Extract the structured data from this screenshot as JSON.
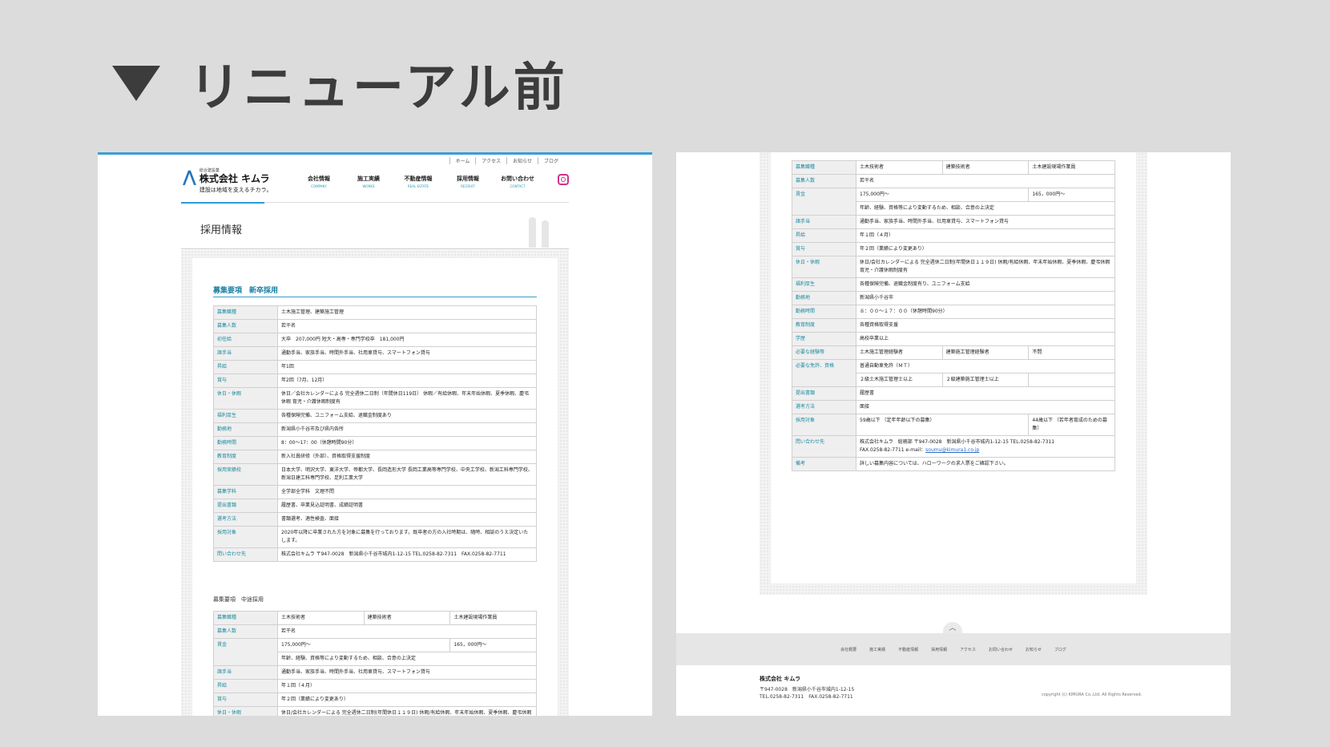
{
  "heading": {
    "title": "リニューアル前"
  },
  "left": {
    "utility_nav": [
      "ホーム",
      "アクセス",
      "お知らせ",
      "ブログ"
    ],
    "logo": {
      "sub": "総合建設業",
      "name": "株式会社 キムラ",
      "tagline": "建設は地域を支えるチカラ。"
    },
    "global_nav": [
      {
        "jp": "会社情報",
        "en": "COMPANY"
      },
      {
        "jp": "施工実績",
        "en": "WORKS"
      },
      {
        "jp": "不動産情報",
        "en": "REAL ESTATE"
      },
      {
        "jp": "採用情報",
        "en": "RECRUIT"
      },
      {
        "jp": "お問い合わせ",
        "en": "CONTACT"
      }
    ],
    "page_title": "採用情報",
    "new_grad": {
      "heading": "募集要項　新卒採用",
      "rows": [
        [
          "募集職種",
          "土木施工管理、建築施工管理"
        ],
        [
          "募集人数",
          "若干名"
        ],
        [
          "初任給",
          "大卒　207,000円 短大・高専・専門学校卒　181,000円"
        ],
        [
          "諸手当",
          "通勤手当、家族手当、時間外手当、社用車貸与、スマートフォン貸与"
        ],
        [
          "昇給",
          "年1回"
        ],
        [
          "賞与",
          "年2回（7月、12月）"
        ],
        [
          "休日・休暇",
          "休日／会社カレンダーによる 完全週休二日制（年間休日119日） 休暇／有給休暇、年末年始休暇、夏季休暇、慶弔休暇 育児・介護休暇制度有"
        ],
        [
          "福利厚生",
          "各種保険完備、ユニフォーム支給、退職金制度あり"
        ],
        [
          "勤務地",
          "新潟県小千谷市及び県内各所"
        ],
        [
          "勤務時間",
          "8：00〜17：00（休憩時間90分）"
        ],
        [
          "教育制度",
          "新入社員研修（外部）、資格取得支援制度"
        ],
        [
          "採用実績校",
          "日本大学、明沢大学、東洋大学、帝都大学、長岡造形大学 長岡工業高等専門学校、中央工学校、新潟工科専門学校、新潟日建工科専門学校、足利工業大学"
        ],
        [
          "募集学科",
          "全学部全学科　文理不問"
        ],
        [
          "提出書類",
          "履歴書、卒業見込証明書、成績証明書"
        ],
        [
          "選考方法",
          "書類選考、適性検査、面接"
        ],
        [
          "採用対象",
          "2020年以降に卒業された方を対象に募集を行っております。既卒者の方の入社時期は、随時、相談のうえ決定いたします。"
        ],
        [
          "問い合わせ先",
          "株式会社キムラ 〒947-0028　新潟県小千谷市城内1-12-15 TEL.0258-82-7311　FAX.0258-82-7711"
        ]
      ]
    },
    "mid_career_heading": "募集要項　中途採用",
    "mid_rows": {
      "job": {
        "k": "募集職種",
        "c1": "土木技術者",
        "c2": "建築技術者",
        "c3": "土木建設現場作業員"
      },
      "count": {
        "k": "募集人数",
        "v": "若干名"
      },
      "wage": {
        "k": "賃金",
        "v1": "175,000円〜",
        "v2": "165，000円〜",
        "note": "年齢、経験、資格等により変動するため、相談、合意の上決定"
      },
      "allow": {
        "k": "諸手当",
        "v": "通勤手当、家族手当、時間外手当、社用車貸与、スマートフォン貸与"
      },
      "raise": {
        "k": "昇給",
        "v": "年１回（４月）"
      },
      "bonus": {
        "k": "賞与",
        "v": "年２回（業績により変更あり）"
      },
      "holiday": {
        "k": "休日・休暇",
        "v": "休日/会社カレンダーによる 完全週休二日制(年間休日１１９日) 休暇/有給休暇、年末年始休暇、夏季休暇、慶弔休暇　育児・介護休暇制度有"
      }
    }
  },
  "right": {
    "rows": {
      "job": {
        "k": "募集職種",
        "c1": "土木技術者",
        "c2": "建築技術者",
        "c3": "土木建設現場作業員"
      },
      "count": {
        "k": "募集人数",
        "v": "若干名"
      },
      "wage": {
        "k": "賃金",
        "v1": "175,000円〜",
        "v2": "165，000円〜",
        "note": "年齢、経験、資格等により変動するため、相談、合意の上決定"
      },
      "allow": {
        "k": "諸手当",
        "v": "通勤手当、家族手当、時間外手当、社用車貸与、スマートフォン貸与"
      },
      "raise": {
        "k": "昇給",
        "v": "年１回（４月）"
      },
      "bonus": {
        "k": "賞与",
        "v": "年２回（業績により変更あり）"
      },
      "holiday": {
        "k": "休日・休暇",
        "v": "休日/会社カレンダーによる 完全週休二日制(年間休日１１９日) 休暇/有給休暇、年末年始休暇、夏季休暇、慶弔休暇　育児・介護休暇制度有"
      },
      "welfare": {
        "k": "福利厚生",
        "v": "各種保険完備、退職金制度有り、ユニフォーム支給"
      },
      "place": {
        "k": "勤務地",
        "v": "新潟県小千谷市"
      },
      "hours": {
        "k": "勤務時間",
        "v": "８：００〜１７：００（休憩時間90分）"
      },
      "edu": {
        "k": "教育制度",
        "v": "各種資格取得支援"
      },
      "school": {
        "k": "学歴",
        "v": "高校卒業以上"
      },
      "exp": {
        "k": "必要な経験等",
        "c1": "土木施工管理経験者",
        "c2": "建築施工管理経験者",
        "c3": "不問"
      },
      "license": {
        "k": "必要な免許、資格",
        "v": "普通自動車免許（ＭＴ）",
        "c1": "２級土木施工管理士以上",
        "c2": "２級建築施工管理士以上"
      },
      "docs": {
        "k": "提出書類",
        "v": "履歴書"
      },
      "select": {
        "k": "選考方法",
        "v": "面接"
      },
      "target": {
        "k": "採用対象",
        "v1": "59歳以下 （定年年齢以下の募集）",
        "v2": "44歳以下 （若年者育成のための募集）"
      },
      "contact": {
        "k": "問い合わせ先",
        "line1": "株式会社キムラ　総務部 〒947-0028　新潟県小千谷市城内1-12-15 TEL.0258-82-7311",
        "line2": "FAX.0258-82-7711 e-mail：",
        "email": "soumu@kimura1.co.jp"
      },
      "remarks": {
        "k": "備考",
        "v": "詳しい募集内容については、ハローワークの求人票をご確認下さい。"
      }
    },
    "footer_nav": [
      "会社概要",
      "施工実績",
      "不動産情報",
      "採用情報",
      "アクセス",
      "お問い合わせ",
      "お知らせ",
      "ブログ"
    ],
    "footer": {
      "company": "株式会社 キムラ",
      "address": "〒947-0028　新潟県小千谷市城内1-12-15\nTEL.0258-82-7311　FAX.0258-82-7711",
      "copyright": "copyright (c) KIMURA Co.,Ltd. All Rights Reserved."
    }
  }
}
